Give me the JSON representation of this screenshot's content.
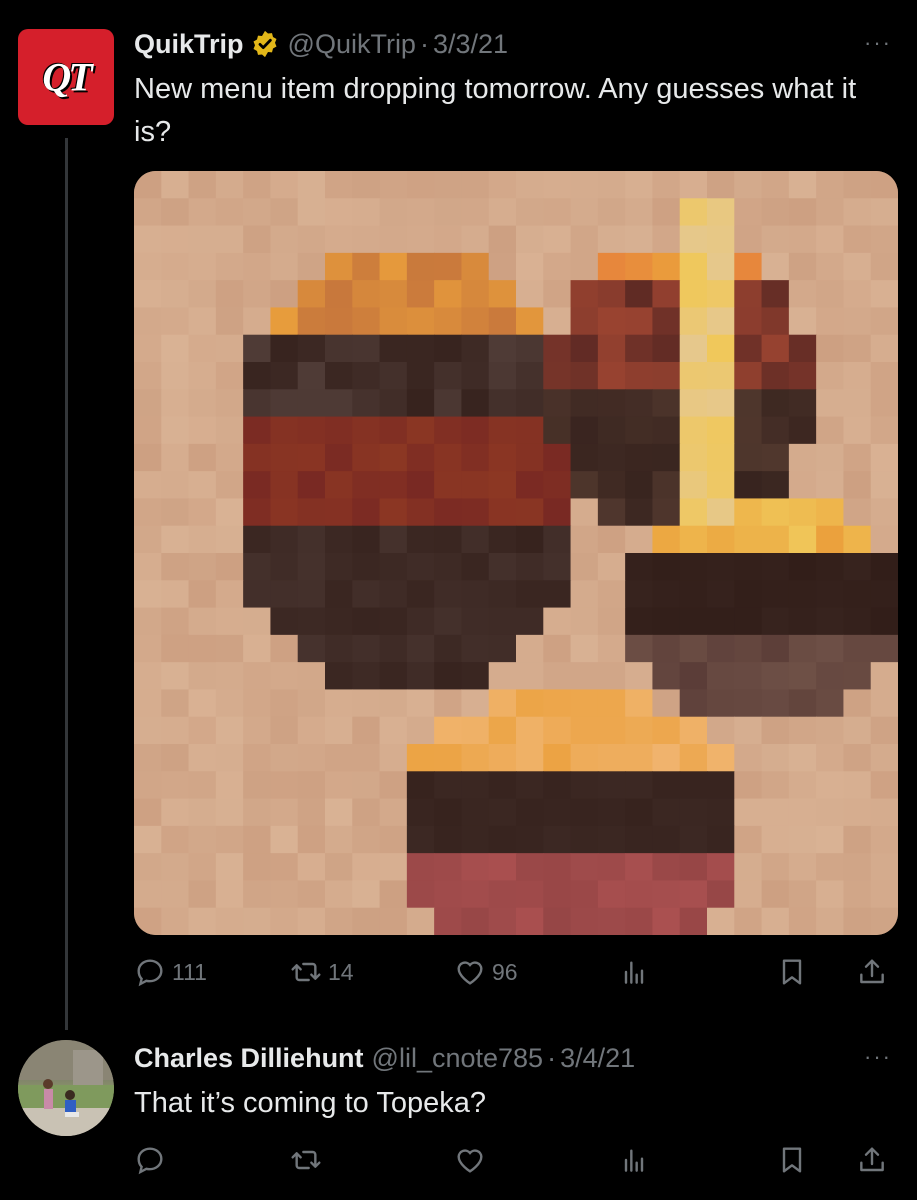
{
  "tweets": [
    {
      "name": "QuikTrip",
      "handle": "@QuikTrip",
      "date": "3/3/21",
      "text": "New menu item dropping tomorrow. Any guesses what it is?",
      "avatar_text": "QT",
      "verified": true,
      "counts": {
        "replies": "111",
        "retweets": "14",
        "likes": "96"
      }
    },
    {
      "name": "Charles Dilliehunt",
      "handle": "@lil_cnote785",
      "date": "3/4/21",
      "text": "That it’s coming to Topeka?"
    }
  ],
  "separator": "·",
  "more_glyph": "···",
  "colors": {
    "background": "#000000",
    "text": "#e7e9ea",
    "muted": "#71767b",
    "brand_red": "#d51f2b",
    "verified_gold": "#e2b719"
  },
  "icons": [
    "reply-icon",
    "retweet-icon",
    "like-icon",
    "views-icon",
    "bookmark-icon",
    "share-icon",
    "verified-icon",
    "more-icon"
  ]
}
